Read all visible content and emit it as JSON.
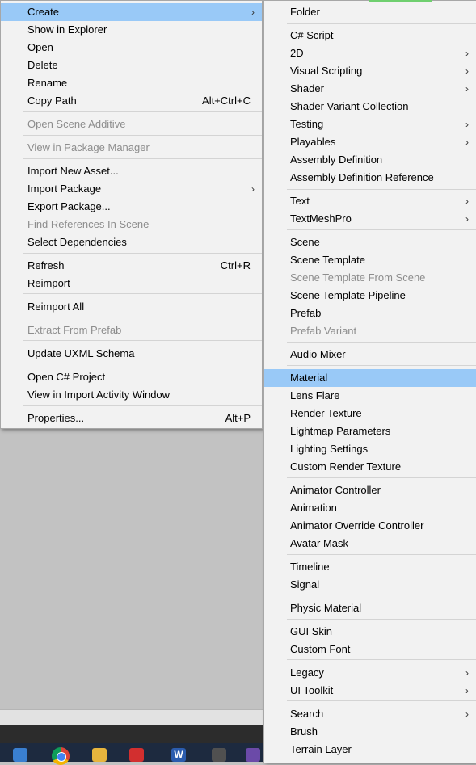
{
  "left_menu": {
    "items": [
      {
        "label": "Create",
        "shortcut": "",
        "submenu": true,
        "disabled": false,
        "highlighted": true
      },
      {
        "label": "Show in Explorer",
        "shortcut": "",
        "submenu": false,
        "disabled": false
      },
      {
        "label": "Open",
        "shortcut": "",
        "submenu": false,
        "disabled": false
      },
      {
        "label": "Delete",
        "shortcut": "",
        "submenu": false,
        "disabled": false
      },
      {
        "label": "Rename",
        "shortcut": "",
        "submenu": false,
        "disabled": false
      },
      {
        "label": "Copy Path",
        "shortcut": "Alt+Ctrl+C",
        "submenu": false,
        "disabled": false
      },
      {
        "label": "Open Scene Additive",
        "shortcut": "",
        "submenu": false,
        "disabled": true
      },
      {
        "label": "View in Package Manager",
        "shortcut": "",
        "submenu": false,
        "disabled": true
      },
      {
        "label": "Import New Asset...",
        "shortcut": "",
        "submenu": false,
        "disabled": false
      },
      {
        "label": "Import Package",
        "shortcut": "",
        "submenu": true,
        "disabled": false
      },
      {
        "label": "Export Package...",
        "shortcut": "",
        "submenu": false,
        "disabled": false
      },
      {
        "label": "Find References In Scene",
        "shortcut": "",
        "submenu": false,
        "disabled": true
      },
      {
        "label": "Select Dependencies",
        "shortcut": "",
        "submenu": false,
        "disabled": false
      },
      {
        "label": "Refresh",
        "shortcut": "Ctrl+R",
        "submenu": false,
        "disabled": false
      },
      {
        "label": "Reimport",
        "shortcut": "",
        "submenu": false,
        "disabled": false
      },
      {
        "label": "Reimport All",
        "shortcut": "",
        "submenu": false,
        "disabled": false
      },
      {
        "label": "Extract From Prefab",
        "shortcut": "",
        "submenu": false,
        "disabled": true
      },
      {
        "label": "Update UXML Schema",
        "shortcut": "",
        "submenu": false,
        "disabled": false
      },
      {
        "label": "Open C# Project",
        "shortcut": "",
        "submenu": false,
        "disabled": false
      },
      {
        "label": "View in Import Activity Window",
        "shortcut": "",
        "submenu": false,
        "disabled": false
      },
      {
        "label": "Properties...",
        "shortcut": "Alt+P",
        "submenu": false,
        "disabled": false
      }
    ]
  },
  "right_menu": {
    "items": [
      {
        "label": "Folder",
        "submenu": false,
        "disabled": false
      },
      {
        "label": "C# Script",
        "submenu": false,
        "disabled": false
      },
      {
        "label": "2D",
        "submenu": true,
        "disabled": false
      },
      {
        "label": "Visual Scripting",
        "submenu": true,
        "disabled": false
      },
      {
        "label": "Shader",
        "submenu": true,
        "disabled": false
      },
      {
        "label": "Shader Variant Collection",
        "submenu": false,
        "disabled": false
      },
      {
        "label": "Testing",
        "submenu": true,
        "disabled": false
      },
      {
        "label": "Playables",
        "submenu": true,
        "disabled": false
      },
      {
        "label": "Assembly Definition",
        "submenu": false,
        "disabled": false
      },
      {
        "label": "Assembly Definition Reference",
        "submenu": false,
        "disabled": false
      },
      {
        "label": "Text",
        "submenu": true,
        "disabled": false
      },
      {
        "label": "TextMeshPro",
        "submenu": true,
        "disabled": false
      },
      {
        "label": "Scene",
        "submenu": false,
        "disabled": false
      },
      {
        "label": "Scene Template",
        "submenu": false,
        "disabled": false
      },
      {
        "label": "Scene Template From Scene",
        "submenu": false,
        "disabled": true
      },
      {
        "label": "Scene Template Pipeline",
        "submenu": false,
        "disabled": false
      },
      {
        "label": "Prefab",
        "submenu": false,
        "disabled": false
      },
      {
        "label": "Prefab Variant",
        "submenu": false,
        "disabled": true
      },
      {
        "label": "Audio Mixer",
        "submenu": false,
        "disabled": false
      },
      {
        "label": "Material",
        "submenu": false,
        "disabled": false,
        "highlighted": true
      },
      {
        "label": "Lens Flare",
        "submenu": false,
        "disabled": false
      },
      {
        "label": "Render Texture",
        "submenu": false,
        "disabled": false
      },
      {
        "label": "Lightmap Parameters",
        "submenu": false,
        "disabled": false
      },
      {
        "label": "Lighting Settings",
        "submenu": false,
        "disabled": false
      },
      {
        "label": "Custom Render Texture",
        "submenu": false,
        "disabled": false
      },
      {
        "label": "Animator Controller",
        "submenu": false,
        "disabled": false
      },
      {
        "label": "Animation",
        "submenu": false,
        "disabled": false
      },
      {
        "label": "Animator Override Controller",
        "submenu": false,
        "disabled": false
      },
      {
        "label": "Avatar Mask",
        "submenu": false,
        "disabled": false
      },
      {
        "label": "Timeline",
        "submenu": false,
        "disabled": false
      },
      {
        "label": "Signal",
        "submenu": false,
        "disabled": false
      },
      {
        "label": "Physic Material",
        "submenu": false,
        "disabled": false
      },
      {
        "label": "GUI Skin",
        "submenu": false,
        "disabled": false
      },
      {
        "label": "Custom Font",
        "submenu": false,
        "disabled": false
      },
      {
        "label": "Legacy",
        "submenu": true,
        "disabled": false
      },
      {
        "label": "UI Toolkit",
        "submenu": true,
        "disabled": false
      },
      {
        "label": "Search",
        "submenu": true,
        "disabled": false
      },
      {
        "label": "Brush",
        "submenu": false,
        "disabled": false
      },
      {
        "label": "Terrain Layer",
        "submenu": false,
        "disabled": false
      }
    ]
  },
  "taskbar": {
    "icons": [
      "windows-app-icon",
      "chrome-icon",
      "file-explorer-icon",
      "wps-icon",
      "word-icon",
      "unity-icon",
      "visual-studio-icon"
    ],
    "word_letter": "W"
  },
  "colors": {
    "highlight": "#99c9f7",
    "menu_bg": "#f2f2f2",
    "disabled_text": "#8d8d8d"
  }
}
